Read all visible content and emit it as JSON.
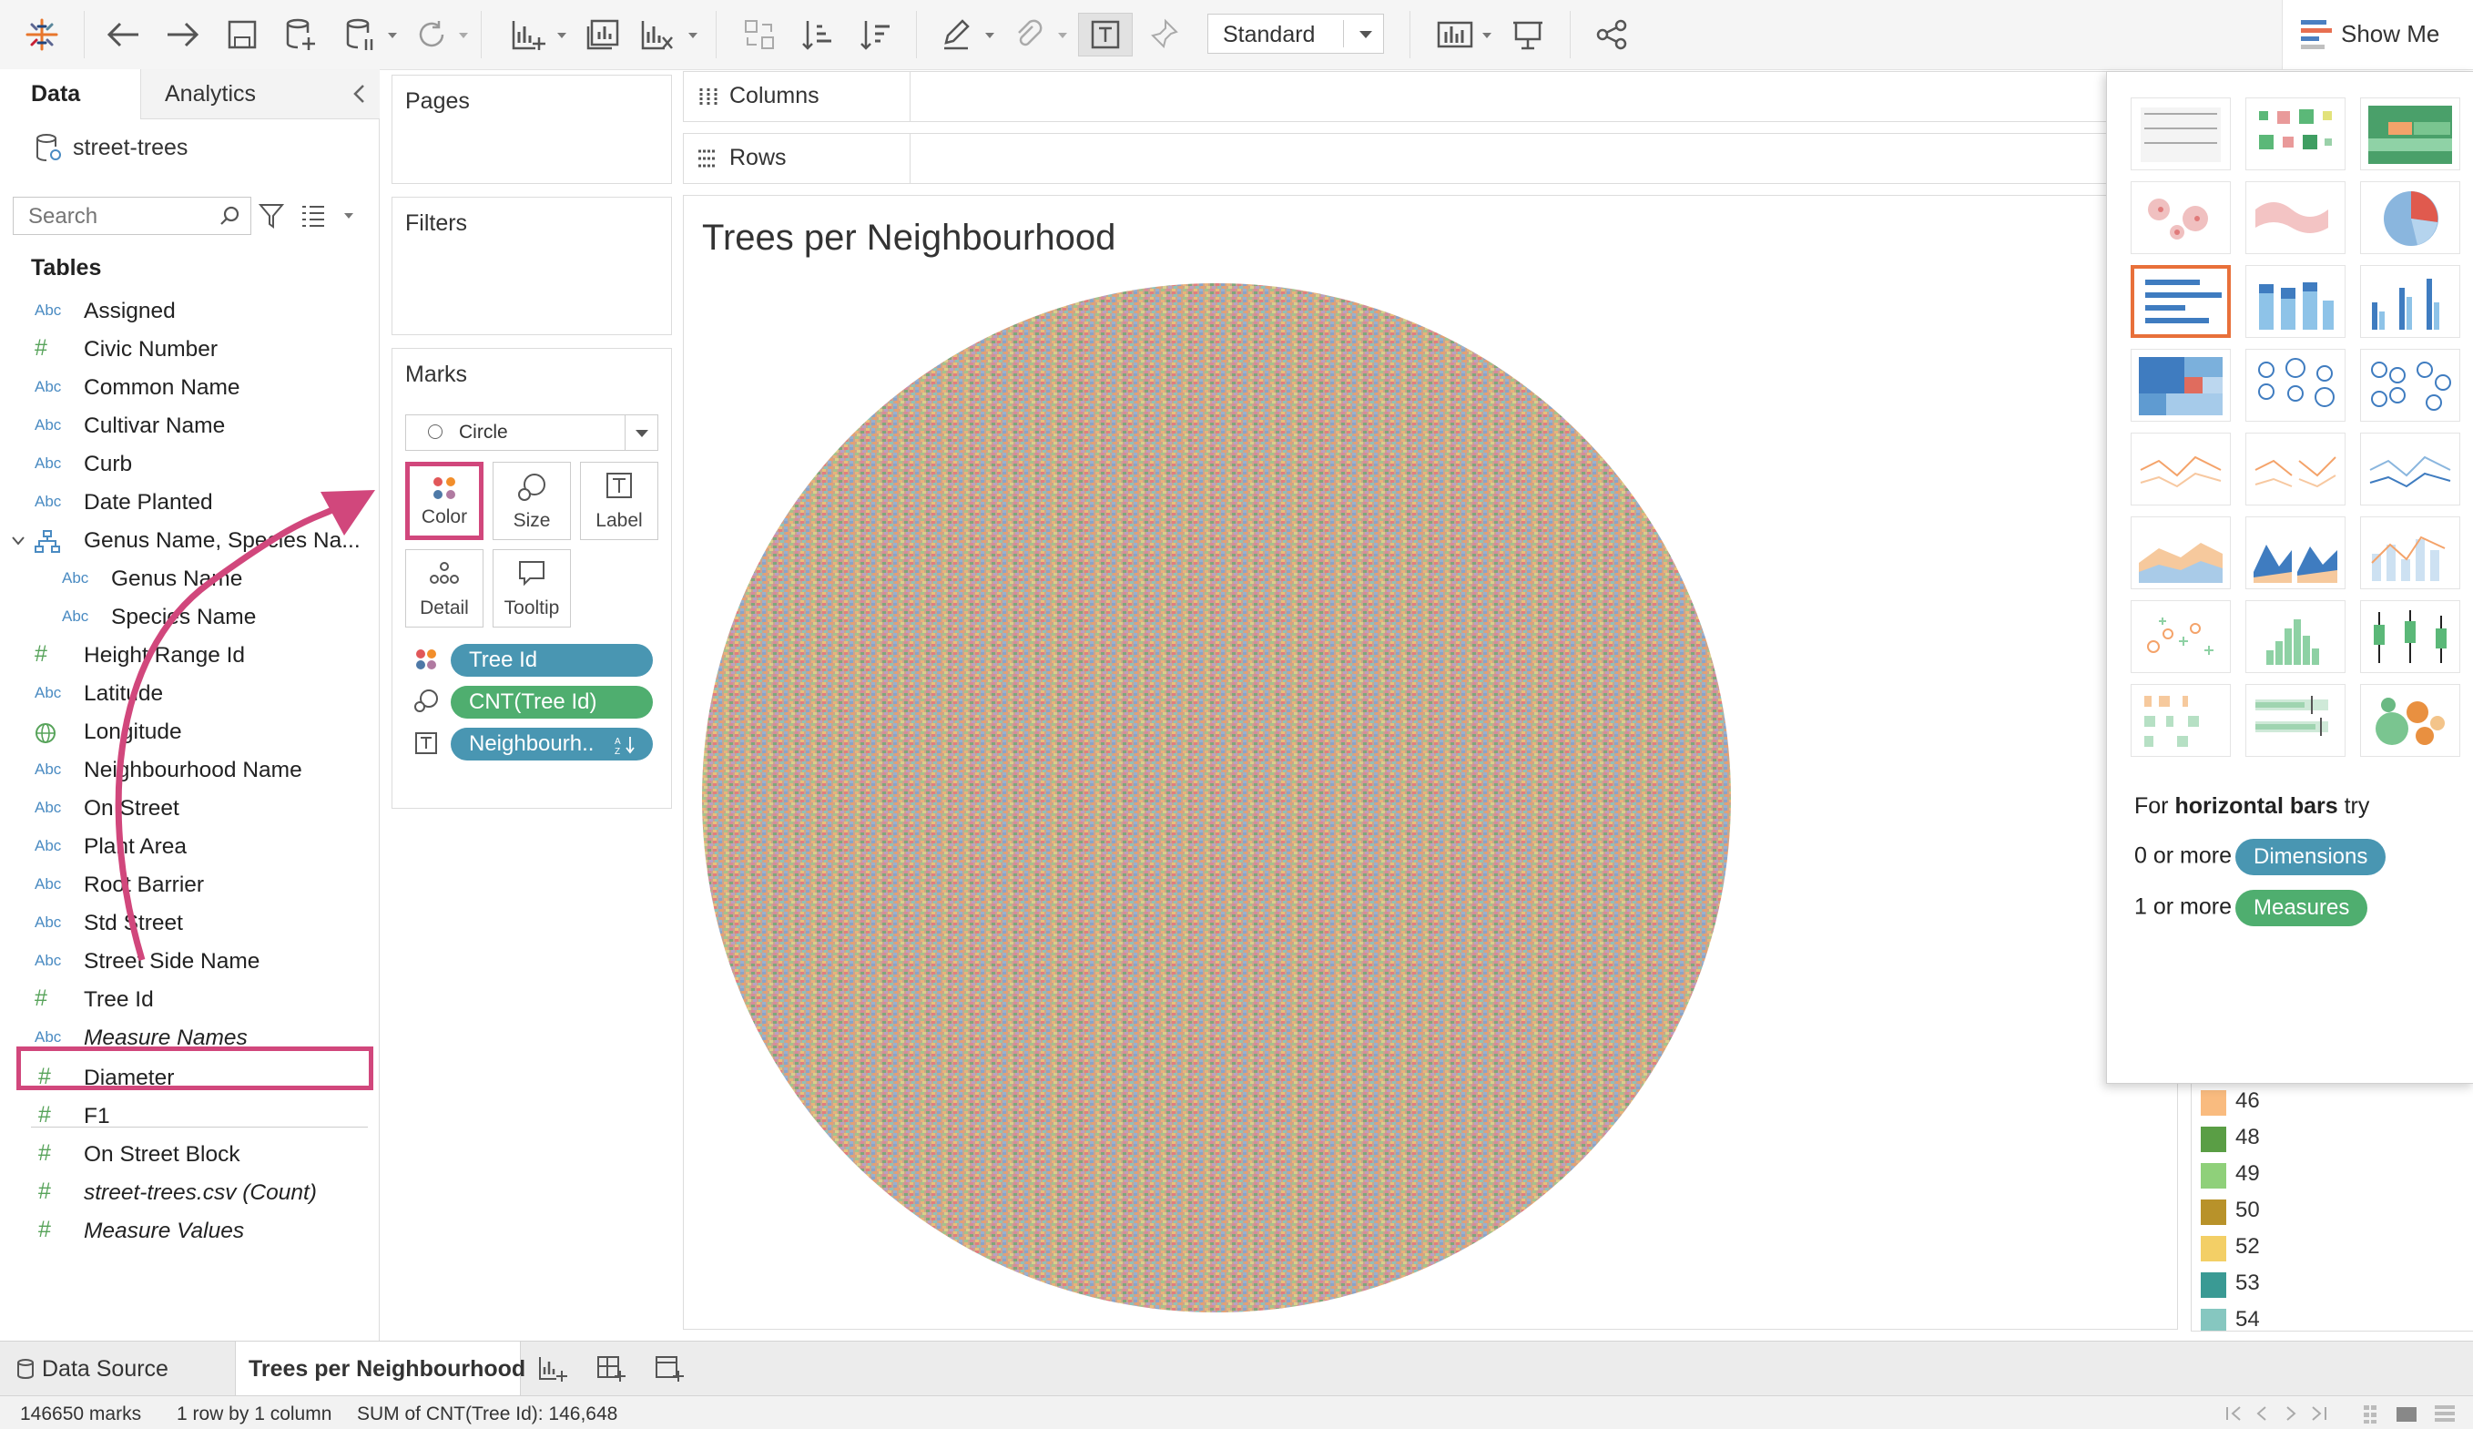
{
  "toolbar": {
    "standard_label": "Standard",
    "show_me_label": "Show Me",
    "icons": [
      "tableau-logo-icon",
      "undo-icon",
      "redo-icon",
      "save-icon",
      "new-datasource-icon",
      "pause-updates-icon",
      "refresh-icon",
      "new-worksheet-icon",
      "duplicate-sheet-icon",
      "clear-sheet-icon",
      "swap-rows-columns-icon",
      "sort-ascending-icon",
      "sort-descending-icon",
      "highlight-icon",
      "group-members-icon",
      "show-mark-labels-icon",
      "fix-axes-icon",
      "fit-icon",
      "presentation-mode-icon",
      "share-icon"
    ]
  },
  "data_pane": {
    "tab_data": "Data",
    "tab_analytics": "Analytics",
    "datasource": "street-trees",
    "search_placeholder": "Search",
    "tables_heading": "Tables",
    "fields": [
      {
        "type": "Abc",
        "name": "Assigned"
      },
      {
        "type": "#",
        "name": "Civic Number"
      },
      {
        "type": "Abc",
        "name": "Common Name"
      },
      {
        "type": "Abc",
        "name": "Cultivar Name"
      },
      {
        "type": "Abc",
        "name": "Curb"
      },
      {
        "type": "Abc",
        "name": "Date Planted"
      },
      {
        "type": "hier",
        "name": "Genus Name, Species Na..."
      },
      {
        "type": "Abc",
        "name": "Genus Name"
      },
      {
        "type": "Abc",
        "name": "Species Name"
      },
      {
        "type": "#",
        "name": "Height Range Id"
      },
      {
        "type": "Abc",
        "name": "Latitude"
      },
      {
        "type": "geo",
        "name": "Longitude"
      },
      {
        "type": "Abc",
        "name": "Neighbourhood Name"
      },
      {
        "type": "Abc",
        "name": "On Street"
      },
      {
        "type": "Abc",
        "name": "Plant Area"
      },
      {
        "type": "Abc",
        "name": "Root Barrier"
      },
      {
        "type": "Abc",
        "name": "Std Street"
      },
      {
        "type": "Abc",
        "name": "Street Side Name"
      },
      {
        "type": "#",
        "name": "Tree Id"
      },
      {
        "type": "Abc",
        "name": "Measure Names"
      }
    ],
    "measures": [
      {
        "type": "#",
        "name": "Diameter"
      },
      {
        "type": "#",
        "name": "F1"
      },
      {
        "type": "#",
        "name": "On Street Block"
      },
      {
        "type": "#",
        "name": "street-trees.csv (Count)"
      },
      {
        "type": "#",
        "name": "Measure Values"
      }
    ]
  },
  "cards": {
    "pages": "Pages",
    "filters": "Filters",
    "marks": "Marks",
    "mark_type": "Circle",
    "buttons": {
      "color": "Color",
      "size": "Size",
      "label": "Label",
      "detail": "Detail",
      "tooltip": "Tooltip"
    },
    "pills": [
      {
        "text": "Tree Id",
        "color": "#4996b2"
      },
      {
        "text": "CNT(Tree Id)",
        "color": "#4fae6f"
      },
      {
        "text": "Neighbourh..",
        "color": "#4996b2"
      }
    ]
  },
  "shelves": {
    "columns": "Columns",
    "rows": "Rows"
  },
  "viz": {
    "title": "Trees per Neighbourhood"
  },
  "legend": [
    {
      "value": "46",
      "color": "#f9bb7f"
    },
    {
      "value": "48",
      "color": "#5a9e45"
    },
    {
      "value": "49",
      "color": "#8fd07a"
    },
    {
      "value": "50",
      "color": "#b8922a"
    },
    {
      "value": "52",
      "color": "#f3cf66"
    },
    {
      "value": "53",
      "color": "#3a9a94"
    },
    {
      "value": "54",
      "color": "#86c7c0"
    }
  ],
  "show_me": {
    "hint_prefix": "For ",
    "hint_bold": "horizontal bars",
    "hint_suffix": " try",
    "dims_prefix": "0 or more",
    "dims_pill": "Dimensions",
    "meas_prefix": "1 or more",
    "meas_pill": "Measures"
  },
  "sheet_tabs": {
    "data_source": "Data Source",
    "active_sheet": "Trees per Neighbourhood"
  },
  "status": {
    "marks": "146650 marks",
    "rows_cols": "1 row by 1 column",
    "sum": "SUM of CNT(Tree Id): 146,648"
  },
  "colors": {
    "annotation": "#d1477c",
    "dimension_pill": "#4996b2",
    "measure_pill": "#4fae6f",
    "selected_chart": "#e8703a"
  }
}
